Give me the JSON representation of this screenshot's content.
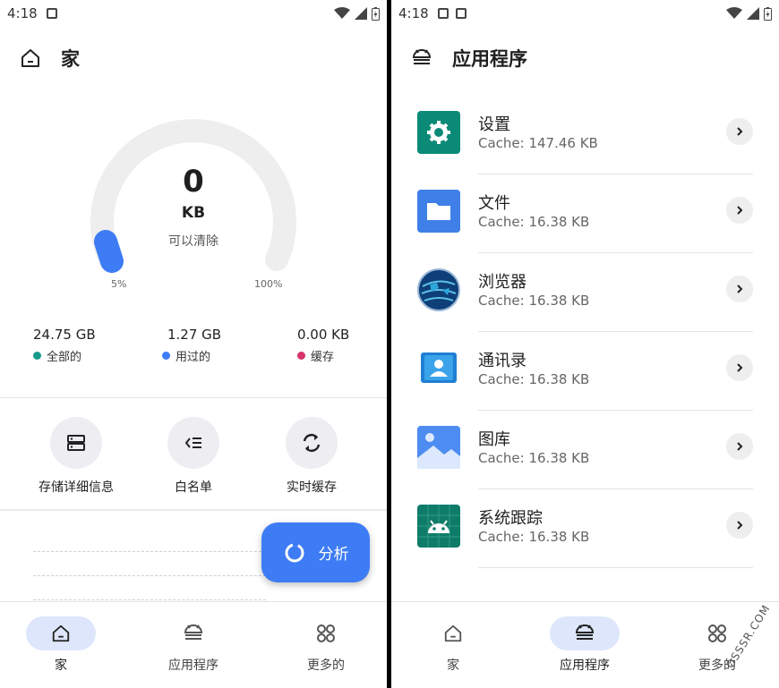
{
  "left": {
    "status": {
      "time": "4:18"
    },
    "appbar": {
      "title": "家",
      "icon": "home-icon"
    },
    "gauge": {
      "value": "0",
      "unit": "KB",
      "subtitle": "可以清除",
      "min_label": "5%",
      "max_label": "100%",
      "level_fraction": 0.05
    },
    "stats": [
      {
        "value": "24.75 GB",
        "label": "全部的",
        "color": "#14998a"
      },
      {
        "value": "1.27 GB",
        "label": "用过的",
        "color": "#3d7cf4"
      },
      {
        "value": "0.00 KB",
        "label": "缓存",
        "color": "#d6336c"
      }
    ],
    "actions": [
      {
        "label": "存储详细信息",
        "icon": "storage-icon"
      },
      {
        "label": "白名单",
        "icon": "whitelist-icon"
      },
      {
        "label": "实时缓存",
        "icon": "refresh-icon"
      }
    ],
    "fab": {
      "label": "分析",
      "icon": "analyze-icon",
      "color": "#3d7cf4"
    },
    "nav": [
      {
        "label": "家",
        "icon": "home-icon",
        "active": true
      },
      {
        "label": "应用程序",
        "icon": "android-icon",
        "active": false
      },
      {
        "label": "更多的",
        "icon": "grid-icon",
        "active": false
      }
    ]
  },
  "right": {
    "status": {
      "time": "4:18"
    },
    "appbar": {
      "title": "应用程序",
      "icon": "android-icon"
    },
    "apps": [
      {
        "name": "设置",
        "cache": "Cache: 147.46 KB",
        "icon": "settings-app-icon",
        "color": "#0b8a78"
      },
      {
        "name": "文件",
        "cache": "Cache: 16.38 KB",
        "icon": "files-app-icon",
        "color": "#3f80e8"
      },
      {
        "name": "浏览器",
        "cache": "Cache: 16.38 KB",
        "icon": "browser-app-icon",
        "color": "#1b5aa3"
      },
      {
        "name": "通讯录",
        "cache": "Cache: 16.38 KB",
        "icon": "contacts-app-icon",
        "color": "#2b9be0"
      },
      {
        "name": "图库",
        "cache": "Cache: 16.38 KB",
        "icon": "gallery-app-icon",
        "color": "#4d8cf0"
      },
      {
        "name": "系统跟踪",
        "cache": "Cache: 16.38 KB",
        "icon": "systrace-app-icon",
        "color": "#0f7c6a"
      }
    ],
    "nav": [
      {
        "label": "家",
        "icon": "home-icon",
        "active": false
      },
      {
        "label": "应用程序",
        "icon": "android-icon",
        "active": true
      },
      {
        "label": "更多的",
        "icon": "grid-icon",
        "active": false
      }
    ]
  },
  "watermark": "OSSSR.COM"
}
